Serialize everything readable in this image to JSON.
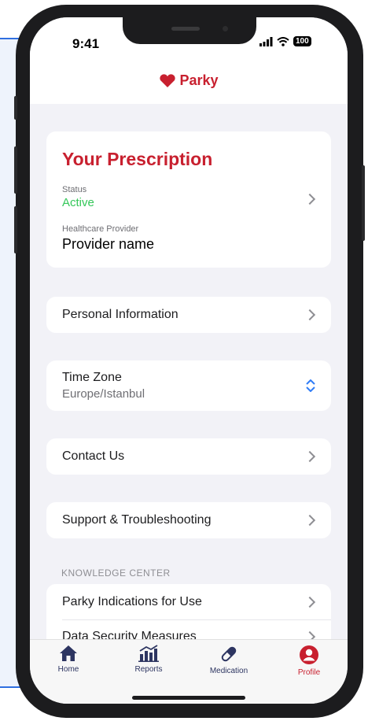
{
  "status_bar": {
    "time": "9:41",
    "battery": "100"
  },
  "brand": {
    "name": "Parky",
    "color": "#c8202f"
  },
  "prescription": {
    "title": "Your Prescription",
    "status_label": "Status",
    "status_value": "Active",
    "provider_label": "Healthcare Provider",
    "provider_value": "Provider name"
  },
  "menu": {
    "personal_info": "Personal Information",
    "time_zone_label": "Time Zone",
    "time_zone_value": "Europe/Istanbul",
    "contact": "Contact Us",
    "support": "Support & Troubleshooting"
  },
  "knowledge_center": {
    "header": "KNOWLEDGE CENTER",
    "items": [
      "Parky Indications for Use",
      "Data Security Measures"
    ]
  },
  "tabs": [
    {
      "label": "Home",
      "icon": "home-icon",
      "active": false
    },
    {
      "label": "Reports",
      "icon": "reports-icon",
      "active": false
    },
    {
      "label": "Medication",
      "icon": "medication-icon",
      "active": false
    },
    {
      "label": "Profile",
      "icon": "profile-icon",
      "active": true
    }
  ],
  "colors": {
    "accent": "#c8202f",
    "active_status": "#34c759",
    "tab_icon": "#2d3561",
    "picker": "#2f7cf6"
  }
}
